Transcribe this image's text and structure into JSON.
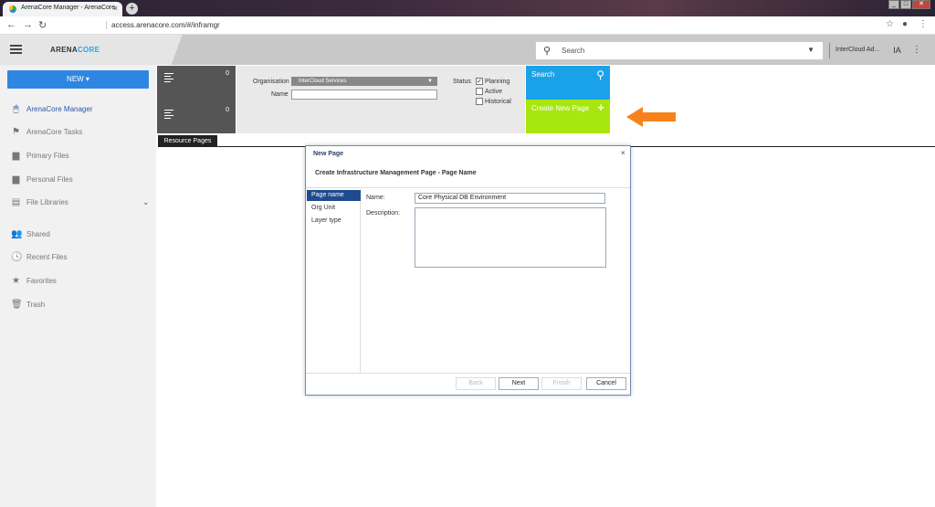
{
  "browser": {
    "tab_title": "ArenaCore Manager - ArenaCore",
    "tab_close": "×",
    "new_tab": "+",
    "url": "access.arenacore.com/#/inframgr",
    "window_buttons": [
      "_",
      "□",
      "✕"
    ]
  },
  "header": {
    "logo_arena": "ARENA",
    "logo_core": "CORE",
    "search_placeholder": "Search",
    "org_name": "InterCloud Ad...",
    "avatar_initials": "IA"
  },
  "sidebar": {
    "new_button": "NEW ▾",
    "items": [
      {
        "label": "ArenaCore Manager",
        "icon": "mouse-icon",
        "glyph": "🖱"
      },
      {
        "label": "ArenaCore Tasks",
        "icon": "flag-icon",
        "glyph": "⚑"
      },
      {
        "label": "Primary Files",
        "icon": "folder-icon",
        "glyph": "▆"
      },
      {
        "label": "Personal Files",
        "icon": "folder-icon",
        "glyph": "▆"
      },
      {
        "label": "File Libraries",
        "icon": "library-icon",
        "glyph": "▤"
      },
      {
        "label": "Shared",
        "icon": "people-icon",
        "glyph": "👥"
      },
      {
        "label": "Recent Files",
        "icon": "clock-icon",
        "glyph": "🕓"
      },
      {
        "label": "Favorites",
        "icon": "star-icon",
        "glyph": "★"
      },
      {
        "label": "Trash",
        "icon": "trash-icon",
        "glyph": "🗑"
      }
    ]
  },
  "tiles": {
    "count_top": "0",
    "count_bottom": "0",
    "search_label": "Search",
    "create_label": "Create New Page",
    "create_plus": "+"
  },
  "filters": {
    "organisation_label": "Organisation",
    "organisation_value": "InterCloud Services",
    "name_label": "Name",
    "status_label": "Status",
    "status_options": [
      {
        "label": "Planning",
        "checked": true
      },
      {
        "label": "Active",
        "checked": false
      },
      {
        "label": "Historical",
        "checked": false
      }
    ]
  },
  "resource_tab": "Resource Pages",
  "dialog": {
    "title": "New Page",
    "close": "×",
    "heading": "Create Infrastructure Management Page - Page Name",
    "steps": [
      "Page name",
      "Org Unit",
      "Layer type"
    ],
    "name_label": "Name:",
    "name_value": "Core Physical DB Environment",
    "description_label": "Description:",
    "buttons": {
      "back": "Back",
      "next": "Next",
      "finish": "Finish",
      "cancel": "Cancel"
    }
  },
  "colors": {
    "accent_blue": "#2f86e2",
    "search_tile": "#1aa2e8",
    "create_tile": "#a8e60f",
    "arrow": "#f7821b"
  }
}
